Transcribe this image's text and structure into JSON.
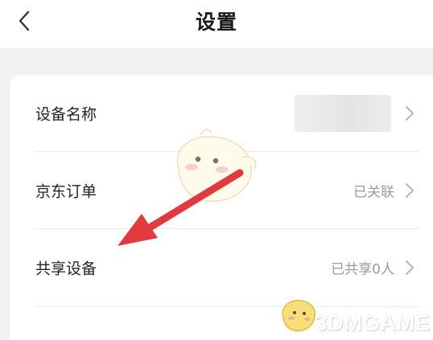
{
  "header": {
    "title": "设置",
    "back_icon": "chevron-left-icon"
  },
  "settings": {
    "rows": [
      {
        "label": "设备名称",
        "value": "",
        "icon": "chevron-right-icon"
      },
      {
        "label": "京东订单",
        "value": "已关联",
        "icon": "chevron-right-icon"
      },
      {
        "label": "共享设备",
        "value": "已共享0人",
        "icon": "chevron-right-icon"
      }
    ]
  },
  "watermark": {
    "text": "3DMGAME"
  },
  "colors": {
    "background": "#f2f2f2",
    "card": "#ffffff",
    "arrow": "#e0393e",
    "text": "#222222",
    "muted": "#9a9a9a"
  }
}
